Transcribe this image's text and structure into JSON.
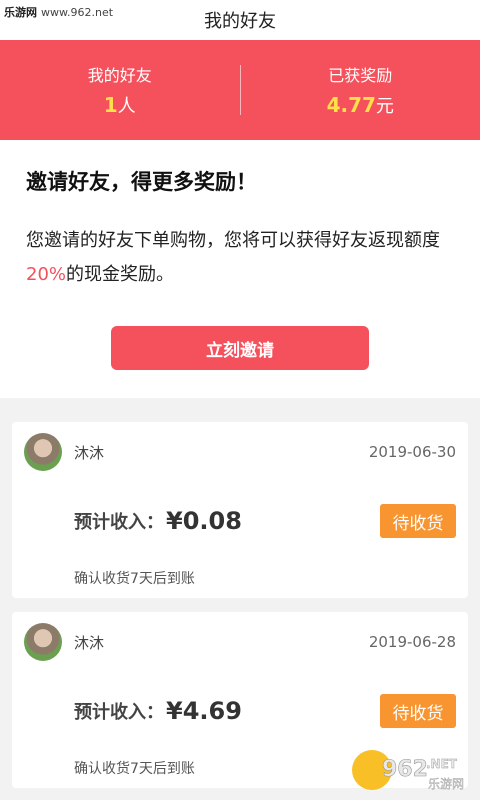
{
  "watermark": {
    "brand": "乐游网",
    "url": "www.962.net",
    "logo_digits": "962",
    "logo_tld": ".NET",
    "logo_cn": "乐游网"
  },
  "header": {
    "title": "我的好友"
  },
  "stats": {
    "friends_label": "我的好友",
    "friends_count": "1",
    "friends_unit": "人",
    "reward_label": "已获奖励",
    "reward_amount": "4.77",
    "reward_unit": "元"
  },
  "invite": {
    "title": "邀请好友，得更多奖励！",
    "desc_before": "您邀请的好友下单购物，您将可以获得好友返现额度",
    "desc_pct": "20%",
    "desc_after": "的现金奖励。",
    "button_label": "立刻邀请"
  },
  "records": [
    {
      "name": "沐沐",
      "date": "2019-06-30",
      "earn_label": "预计收入：",
      "amount": "¥0.08",
      "status": "待收货",
      "note": "确认收货7天后到账"
    },
    {
      "name": "沐沐",
      "date": "2019-06-28",
      "earn_label": "预计收入：",
      "amount": "¥4.69",
      "status": "待收货",
      "note": "确认收货7天后到账"
    }
  ],
  "colors": {
    "accent": "#f4515c",
    "highlight": "#ffe04a",
    "status": "#f89531"
  },
  "icons": {
    "back": "back-arrow-icon"
  }
}
